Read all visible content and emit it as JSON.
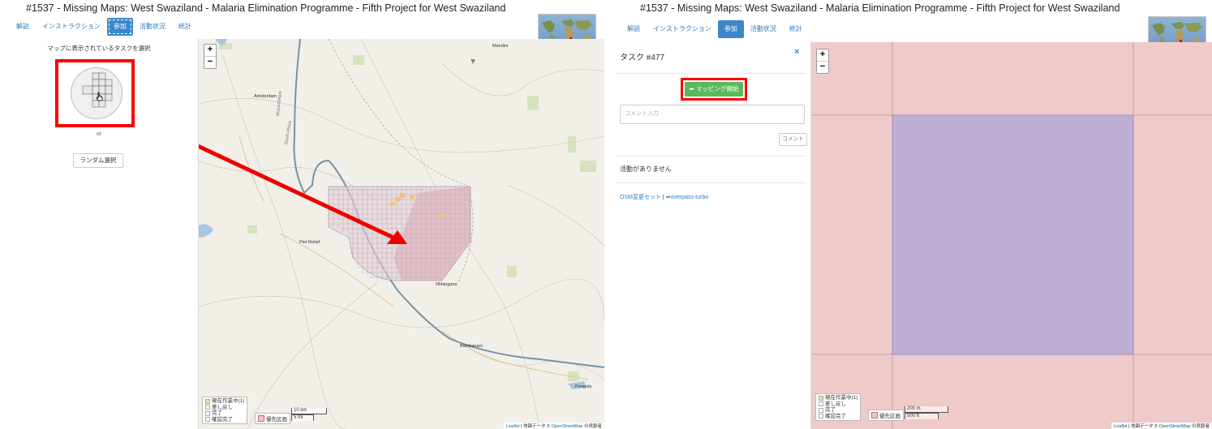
{
  "left": {
    "title": "#1537 - Missing Maps: West Swaziland - Malaria Elimination Programme - Fifth Project for West Swaziland",
    "tabs": [
      "解説",
      "インストラクション",
      "参加",
      "活動状況",
      "統計"
    ],
    "active_tab": "参加",
    "select_prompt": "マップに表示されているタスクを選択",
    "or_text": "or",
    "random_button": "ランダム選択",
    "map": {
      "place_labels": [
        "Mandini",
        "Amsterdam",
        "Piet Retief",
        "Nhlangano",
        "Bambanani",
        "Pongola"
      ],
      "road_labels": [
        "Mozambique",
        "South Africa"
      ],
      "zoom_in": "+",
      "zoom_out": "−",
      "legend": [
        "現在作業中(1)",
        "差し戻し",
        "完了",
        "確認完了"
      ],
      "legend_priority": "優先区画",
      "scale": [
        "10 km",
        "5 mi"
      ],
      "attribution_prefix": "Leaflet",
      "attribution_middle": " | 地図データ © ",
      "attribution_link": "OpenStreetMap",
      "attribution_suffix": " の貢献者"
    }
  },
  "right": {
    "title": "#1537 - Missing Maps: West Swaziland - Malaria Elimination Programme - Fifth Project for West Swaziland",
    "tabs": [
      "解説",
      "インストラクション",
      "参加",
      "活動状況",
      "統計"
    ],
    "active_tab": "参加",
    "task_title": "タスク #477",
    "close_icon": "×",
    "start_mapping_button": "マッピング開始",
    "comment_placeholder": "コメント入力",
    "comment_button": "コメント",
    "no_activity": "活動がありません",
    "osm_changesets": "OSM変更セット",
    "separator": "|",
    "overpass_turbo": "overpass-turbo",
    "map": {
      "zoom_in": "+",
      "zoom_out": "−",
      "legend": [
        "現在作業中(1)",
        "差し戻し",
        "完了",
        "確認完了"
      ],
      "legend_priority": "優先区画",
      "scale": [
        "200 m",
        "500 ft"
      ],
      "attribution_prefix": "Leaflet",
      "attribution_middle": " | 地図データ © ",
      "attribution_link": "OpenStreetMap",
      "attribution_suffix": " の貢献者"
    }
  },
  "colors": {
    "tab_active": "#3a87c9",
    "highlight_box": "#ff0000",
    "start_button": "#5cb85c",
    "priority_fill": "#e8c8c8",
    "locked_task_fill": "#bcaed4",
    "map_bg": "#f2efe9"
  },
  "icons": {
    "pointer": "hand-cursor-icon",
    "start": "share-arrow-icon",
    "overpass": "share-arrow-icon"
  }
}
